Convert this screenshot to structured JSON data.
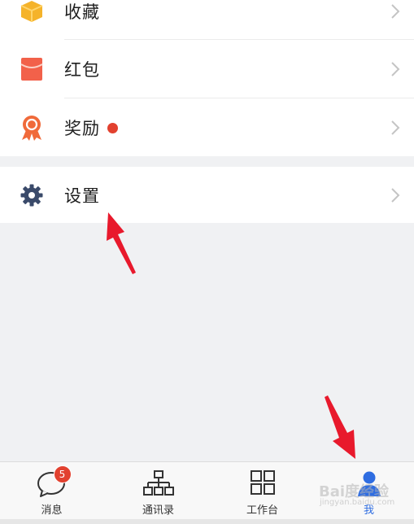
{
  "menu": {
    "favorites_label": "收藏",
    "red_packet_label": "红包",
    "rewards_label": "奖励",
    "settings_label": "设置"
  },
  "tabs": [
    {
      "label": "消息",
      "badge": "5"
    },
    {
      "label": "通讯录"
    },
    {
      "label": "工作台"
    },
    {
      "label": "我"
    }
  ],
  "watermark": {
    "text": "Bai度经验",
    "sub": "jingyan.baidu.com"
  },
  "colors": {
    "accent_blue": "#2f6de1",
    "badge_red": "#e2412f",
    "favorites_yellow": "#f5b32a",
    "red_packet": "#f2614a",
    "rewards_orange": "#f06a3a",
    "settings_gray": "#3a4a6a",
    "annotation_arrow": "#e8192c"
  }
}
